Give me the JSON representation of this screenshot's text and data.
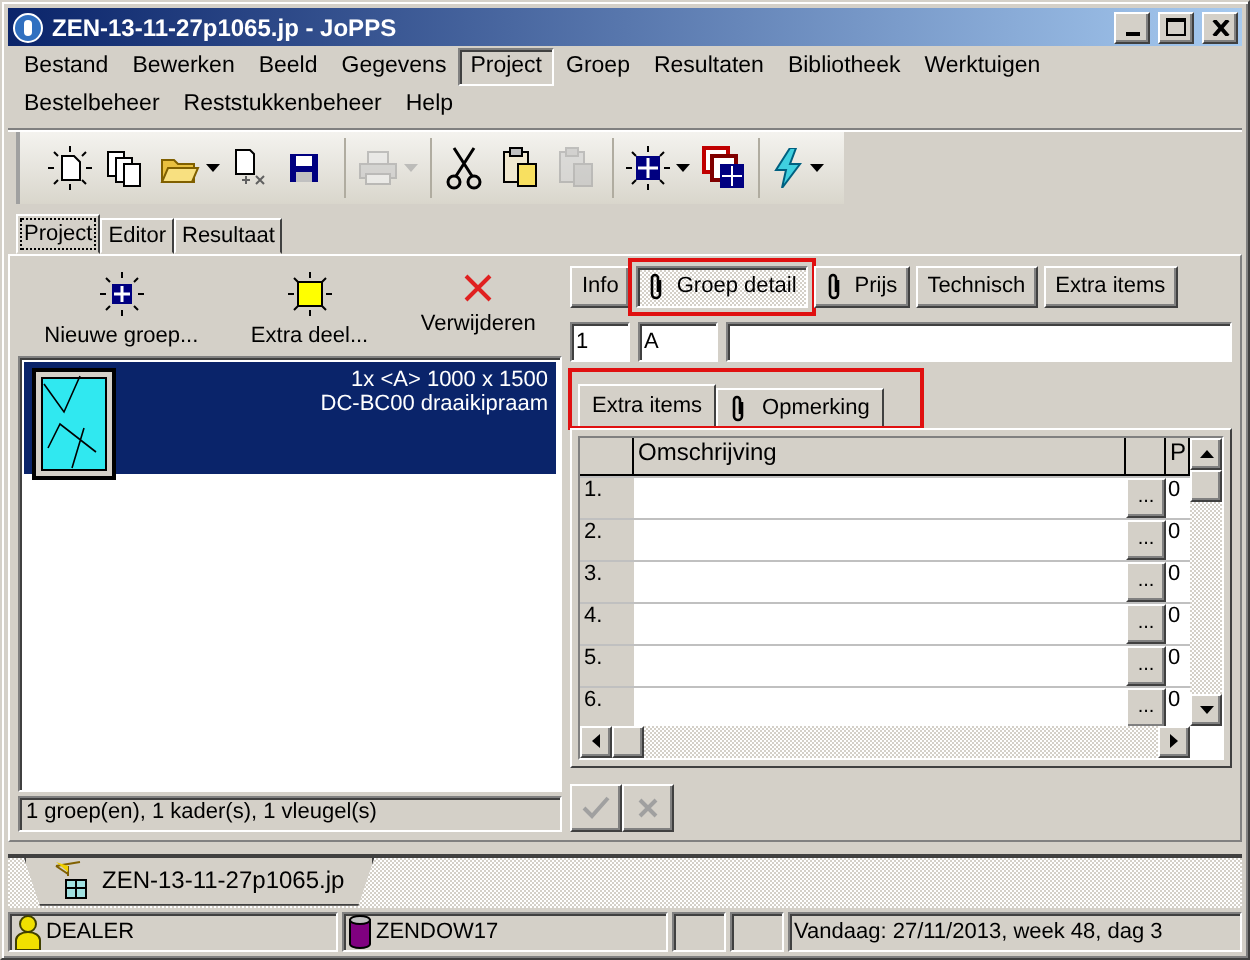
{
  "window": {
    "title": "ZEN-13-11-27p1065.jp - JoPPS",
    "controls": [
      {
        "kind": "minimize"
      },
      {
        "kind": "maximize"
      },
      {
        "kind": "close"
      }
    ]
  },
  "menu": [
    {
      "label": "Bestand",
      "selected": false
    },
    {
      "label": "Bewerken",
      "selected": false
    },
    {
      "label": "Beeld",
      "selected": false
    },
    {
      "label": "Gegevens",
      "selected": false
    },
    {
      "label": "Project",
      "selected": true
    },
    {
      "label": "Groep",
      "selected": false
    },
    {
      "label": "Resultaten",
      "selected": false
    },
    {
      "label": "Bibliotheek",
      "selected": false
    },
    {
      "label": "Werktuigen",
      "selected": false
    },
    {
      "label": "Bestelbeheer",
      "selected": false
    },
    {
      "label": "Reststukkenbeheer",
      "selected": false
    },
    {
      "label": "Help",
      "selected": false
    }
  ],
  "toolbar": [
    [
      {
        "kind": "new",
        "dropdown": false,
        "disabled": false
      },
      {
        "kind": "copy",
        "dropdown": false,
        "disabled": false
      },
      {
        "kind": "open",
        "dropdown": true,
        "disabled": false
      },
      {
        "kind": "export",
        "dropdown": false,
        "disabled": false
      },
      {
        "kind": "save",
        "dropdown": false,
        "disabled": false
      }
    ],
    [
      {
        "kind": "print",
        "dropdown": true,
        "disabled": true
      }
    ],
    [
      {
        "kind": "cut",
        "dropdown": false,
        "disabled": false
      },
      {
        "kind": "paste",
        "dropdown": false,
        "disabled": false
      },
      {
        "kind": "paste",
        "dropdown": false,
        "disabled": true
      }
    ],
    [
      {
        "kind": "grid",
        "dropdown": true,
        "disabled": false
      },
      {
        "kind": "windows",
        "dropdown": false,
        "disabled": false
      }
    ],
    [
      {
        "kind": "lightning",
        "dropdown": true,
        "disabled": false
      }
    ]
  ],
  "tabs": [
    {
      "label": "Project",
      "selected": true
    },
    {
      "label": "Editor",
      "selected": false
    },
    {
      "label": "Resultaat",
      "selected": false
    }
  ],
  "project": {
    "actions": [
      {
        "kind": "new-group",
        "label": "Nieuwe groep..."
      },
      {
        "kind": "extra-part",
        "label": "Extra deel..."
      },
      {
        "kind": "delete",
        "label": "Verwijderen"
      }
    ],
    "groups": [
      {
        "selected": true,
        "title": "1x <A> 1000 x 1500",
        "subtitle": "DC-BC00 draaikipraam"
      }
    ],
    "summary": "1 groep(en), 1 kader(s), 1 vleugel(s)"
  },
  "detail": {
    "buttons": [
      {
        "label": "Info",
        "clip": false,
        "selected": false,
        "highlighted": false
      },
      {
        "label": "Groep detail",
        "clip": true,
        "selected": true,
        "highlighted": true
      },
      {
        "label": "Prijs",
        "clip": true,
        "selected": false,
        "highlighted": false
      },
      {
        "label": "Technisch",
        "clip": false,
        "selected": false,
        "highlighted": false
      },
      {
        "label": "Extra items",
        "clip": false,
        "selected": false,
        "highlighted": false
      }
    ],
    "fields": [
      {
        "value": "1"
      },
      {
        "value": "A"
      },
      {
        "kind": "blank"
      }
    ],
    "subtabs_highlighted": true,
    "subtabs": [
      {
        "label": "Extra items",
        "clip": false,
        "selected": true
      },
      {
        "label": "Opmerking",
        "clip": true,
        "selected": false
      }
    ],
    "grid": {
      "columns": [
        "Omschrijving",
        "P"
      ],
      "rows": [
        {
          "label": "1.",
          "p": "0"
        },
        {
          "label": "2.",
          "p": "0"
        },
        {
          "label": "3.",
          "p": "0"
        },
        {
          "label": "4.",
          "p": "0"
        },
        {
          "label": "5.",
          "p": "0"
        },
        {
          "label": "6.",
          "p": "0"
        }
      ],
      "cell_button": "..."
    },
    "confirm": {
      "disabled": true
    },
    "cancel": {
      "disabled": true
    }
  },
  "documents": [
    {
      "label": "ZEN-13-11-27p1065.jp",
      "selected": true
    }
  ],
  "status_bar": [
    {
      "kind": "user",
      "text": "DEALER"
    },
    {
      "kind": "database",
      "text": "ZENDOW17"
    },
    {
      "kind": "empty"
    },
    {
      "kind": "empty"
    },
    {
      "kind": "text",
      "text": "Vandaag: 27/11/2013, week 48, dag 3"
    }
  ]
}
